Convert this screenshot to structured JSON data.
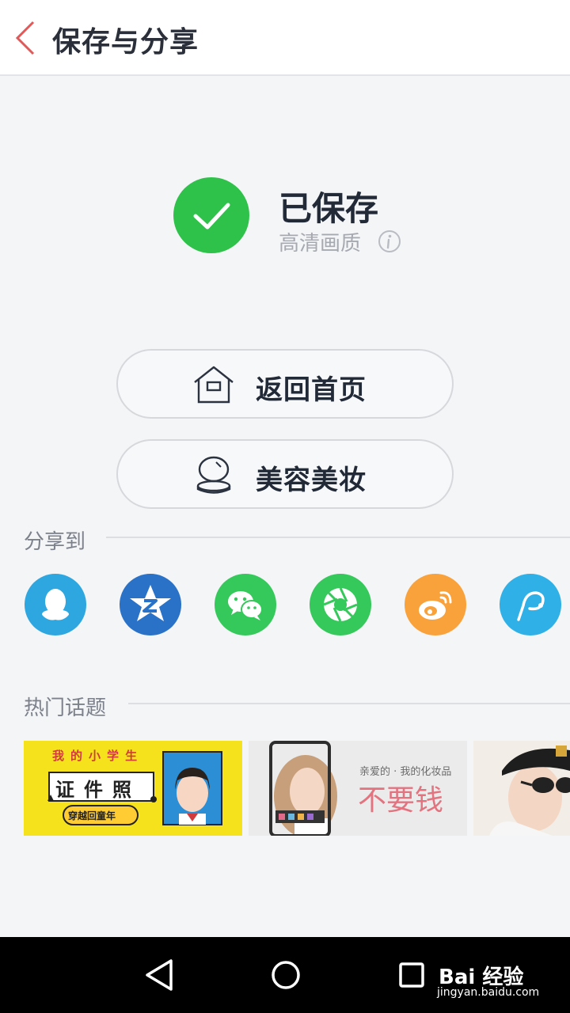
{
  "header": {
    "title": "保存与分享"
  },
  "saved": {
    "title": "已保存",
    "quality": "高清画质"
  },
  "actions": [
    {
      "label": "返回首页",
      "icon": "home-icon"
    },
    {
      "label": "美容美妆",
      "icon": "compact-mirror-icon"
    }
  ],
  "share": {
    "title": "分享到",
    "items": [
      {
        "icon": "qq-icon",
        "color": "#2ea7e0"
      },
      {
        "icon": "qzone-icon",
        "color": "#2a72c8"
      },
      {
        "icon": "wechat-icon",
        "color": "#35c85a"
      },
      {
        "icon": "moments-icon",
        "color": "#35c85a"
      },
      {
        "icon": "weibo-icon",
        "color": "#f9a13a"
      },
      {
        "icon": "meipai-icon",
        "color": "#2fb0e6"
      }
    ]
  },
  "topics": {
    "title": "热门话题",
    "banner1": {
      "line1": [
        "我",
        "的",
        "小",
        "学",
        "生"
      ],
      "line2": [
        "证",
        "件",
        "照"
      ],
      "line3": "穿越回童年"
    },
    "banner2": {
      "line1": "亲爱的 · 我的化妆品",
      "line2": "不要钱"
    }
  },
  "colors": {
    "accent": "#e05a5a",
    "success": "#2fc24a"
  },
  "watermark": {
    "logo": "Bai 经验",
    "url": "jingyan.baidu.com"
  }
}
